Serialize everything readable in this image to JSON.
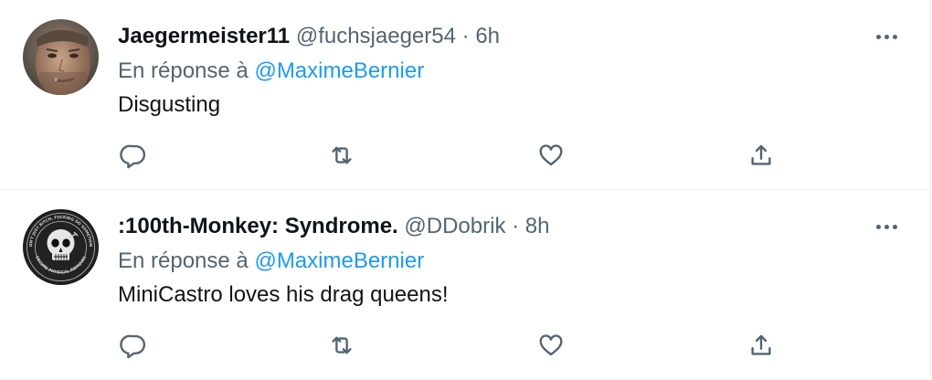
{
  "tweets": [
    {
      "display_name": "Jaegermeister11",
      "handle": "@fuchsjaeger54",
      "separator": "·",
      "time": "6h",
      "reply_prefix": "En réponse à",
      "reply_mention": "@MaximeBernier",
      "text": "Disgusting",
      "icons": {
        "more": "more-horizontal-icon",
        "reply": "reply-icon",
        "retweet": "retweet-icon",
        "like": "like-heart-icon",
        "share": "share-icon"
      }
    },
    {
      "display_name": ":100th-Monkey: Syndrome.",
      "handle": "@DDobrik",
      "separator": "·",
      "time": "8h",
      "reply_prefix": "En réponse à",
      "reply_mention": "@MaximeBernier",
      "text": "MiniCastro loves his drag queens!",
      "avatar_text": {
        "top": "DON'T JUST BITCH, FUCKING DO SOMETHING",
        "bottom": "SECURE PHYSICAL REMOVAL"
      },
      "icons": {
        "more": "more-horizontal-icon",
        "reply": "reply-icon",
        "retweet": "retweet-icon",
        "like": "like-heart-icon",
        "share": "share-icon"
      }
    }
  ],
  "colors": {
    "text_primary": "#0f1419",
    "text_secondary": "#536471",
    "link": "#1d9bf0",
    "divider": "#eff3f4"
  }
}
